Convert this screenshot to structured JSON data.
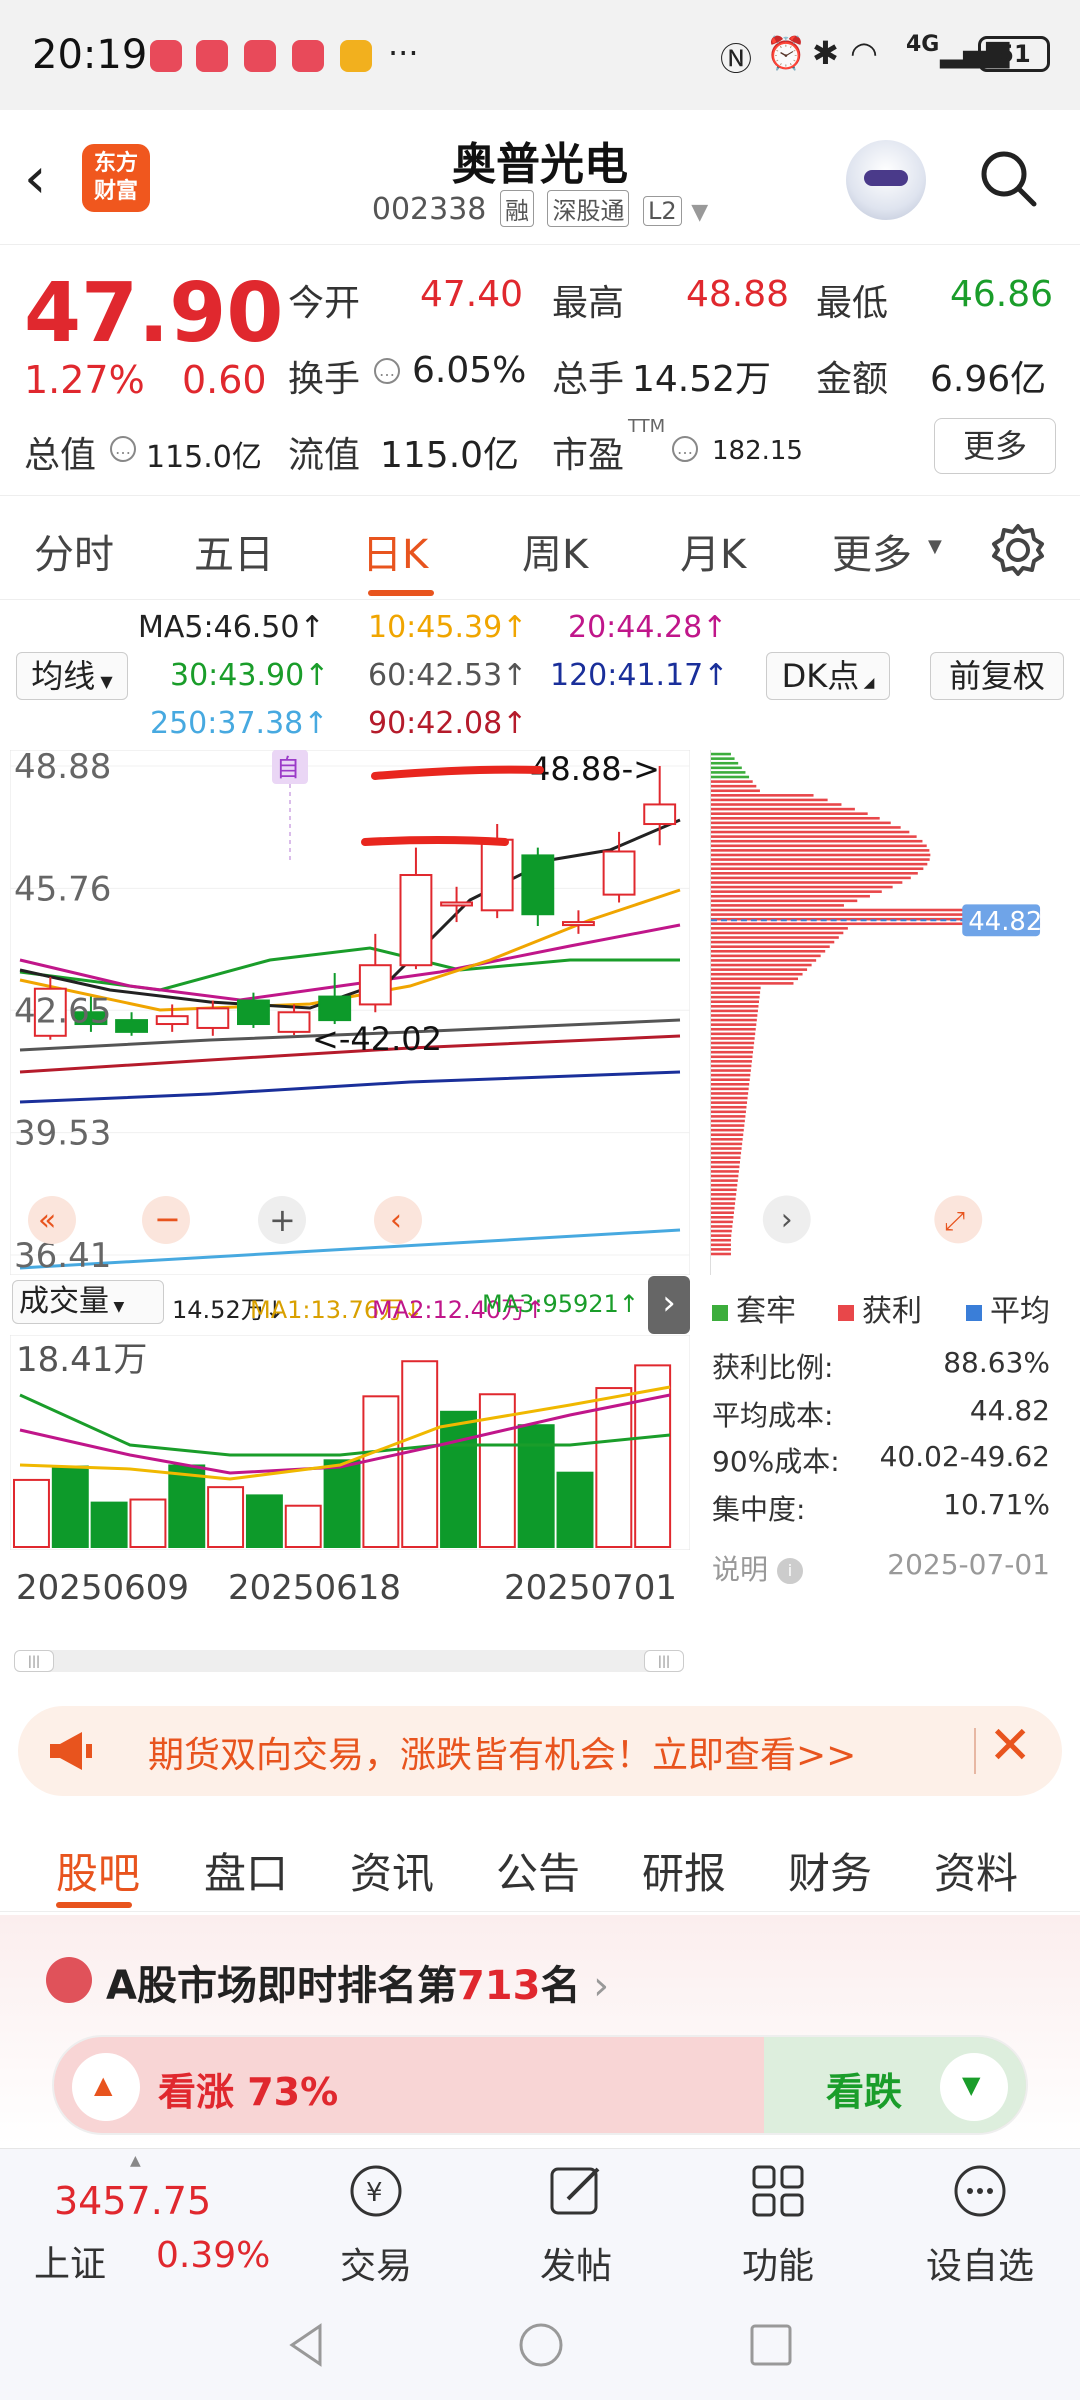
{
  "status_bar": {
    "time": "20:19",
    "battery": "51",
    "network": "4G",
    "icons": [
      "app-icon",
      "app-icon",
      "app-icon",
      "app-icon",
      "weibo-icon",
      "more-icon",
      "nfc-icon",
      "alarm-icon",
      "bluetooth-icon",
      "wifi-icon",
      "signal-icon",
      "battery-icon"
    ]
  },
  "header": {
    "title": "奥普光电",
    "code": "002338",
    "tags": [
      "融",
      "深股通",
      "L2"
    ],
    "logo_line1": "东方",
    "logo_line2": "财富"
  },
  "quote": {
    "price": "47.90",
    "change_pct": "1.27%",
    "change": "0.60",
    "fields": {
      "open_label": "今开",
      "open": "47.40",
      "high_label": "最高",
      "high": "48.88",
      "low_label": "最低",
      "low": "46.86",
      "turnover_label": "换手",
      "turnover": "6.05%",
      "volume_label": "总手",
      "volume": "14.52万",
      "amount_label": "金额",
      "amount": "6.96亿",
      "mcap_label": "总值",
      "mcap": "115.0亿",
      "float_label": "流值",
      "float": "115.0亿",
      "pe_label": "市盈",
      "pe_sup": "TTM",
      "pe": "182.15"
    },
    "more_label": "更多"
  },
  "kline_tabs": [
    "分时",
    "五日",
    "日K",
    "周K",
    "月K",
    "更多"
  ],
  "kline_active": "日K",
  "ma": {
    "ma5": "MA5:46.50↑",
    "ma10": "10:45.39↑",
    "ma20": "20:44.28↑",
    "ma30": "30:43.90↑",
    "ma60": "60:42.53↑",
    "ma120": "120:41.17↑",
    "ma250": "250:37.38↑",
    "ma90": "90:42.08↑",
    "indicator_select": "均线",
    "dk_button": "DK点",
    "adjust_button": "前复权"
  },
  "chart_data": {
    "type": "candlestick",
    "y_ticks": [
      "48.88",
      "45.76",
      "42.65",
      "39.53",
      "36.41"
    ],
    "ylim": [
      36.41,
      48.88
    ],
    "high_label": "48.88->",
    "low_label": "<-42.02",
    "marker": "自",
    "profile_avg_label": "44.82",
    "candles": [
      {
        "o": 42.0,
        "c": 43.2,
        "h": 43.5,
        "l": 41.9
      },
      {
        "o": 42.6,
        "c": 42.3,
        "h": 43.0,
        "l": 42.1
      },
      {
        "o": 42.4,
        "c": 42.1,
        "h": 42.6,
        "l": 42.0
      },
      {
        "o": 42.3,
        "c": 42.5,
        "h": 42.8,
        "l": 42.1
      },
      {
        "o": 42.2,
        "c": 42.7,
        "h": 42.9,
        "l": 42.0
      },
      {
        "o": 42.9,
        "c": 42.3,
        "h": 43.1,
        "l": 42.2
      },
      {
        "o": 42.1,
        "c": 42.6,
        "h": 42.8,
        "l": 42.02
      },
      {
        "o": 43.0,
        "c": 42.4,
        "h": 43.6,
        "l": 42.3
      },
      {
        "o": 42.8,
        "c": 43.8,
        "h": 44.6,
        "l": 42.6
      },
      {
        "o": 43.8,
        "c": 46.1,
        "h": 46.8,
        "l": 43.7
      },
      {
        "o": 45.4,
        "c": 45.4,
        "h": 45.8,
        "l": 44.9
      },
      {
        "o": 45.2,
        "c": 47.0,
        "h": 47.4,
        "l": 45.0
      },
      {
        "o": 46.6,
        "c": 45.1,
        "h": 46.8,
        "l": 44.8
      },
      {
        "o": 44.9,
        "c": 44.9,
        "h": 45.2,
        "l": 44.6
      },
      {
        "o": 45.6,
        "c": 46.7,
        "h": 47.2,
        "l": 45.4
      },
      {
        "o": 47.4,
        "c": 47.9,
        "h": 48.88,
        "l": 46.86
      }
    ],
    "volume": {
      "title": "成交量",
      "header": [
        "14.52万↓",
        "MA1:13.76万↓",
        "MA2:12.40万↑",
        "MA3:95921↑"
      ],
      "y_label": "18.41万",
      "bars": [
        6.5,
        7.8,
        4.3,
        4.6,
        7.9,
        5.8,
        5.0,
        4.0,
        8.4,
        14.6,
        18.0,
        13.1,
        14.8,
        11.8,
        7.2,
        15.4,
        17.6
      ],
      "up": [
        true,
        false,
        false,
        true,
        false,
        true,
        false,
        true,
        false,
        true,
        true,
        false,
        true,
        false,
        false,
        true,
        true
      ],
      "dates": [
        "20250609",
        "20250618",
        "20250701"
      ]
    }
  },
  "profile_stats": {
    "legend": [
      "套牢",
      "获利",
      "平均"
    ],
    "rows": [
      {
        "label": "获利比例:",
        "value": "88.63%"
      },
      {
        "label": "平均成本:",
        "value": "44.82"
      },
      {
        "label": "90%成本:",
        "value": "40.02-49.62"
      },
      {
        "label": "集中度:",
        "value": "10.71%"
      }
    ],
    "note_label": "说明",
    "date": "2025-07-01"
  },
  "banner": {
    "text": "期货双向交易，涨跌皆有机会！立即查看>>"
  },
  "bottom_tabs": [
    "股吧",
    "盘口",
    "资讯",
    "公告",
    "研报",
    "财务",
    "资料"
  ],
  "rank": {
    "prefix": "A股市场即时排名第",
    "number": "713",
    "suffix": "名",
    "bull": "看涨 73%",
    "bear": "看跌",
    "bull_pct": 73
  },
  "bottom_nav": {
    "index_value": "3457.75",
    "index_name": "上证",
    "index_change": "0.39%",
    "items": [
      "交易",
      "发帖",
      "功能",
      "设自选"
    ]
  }
}
